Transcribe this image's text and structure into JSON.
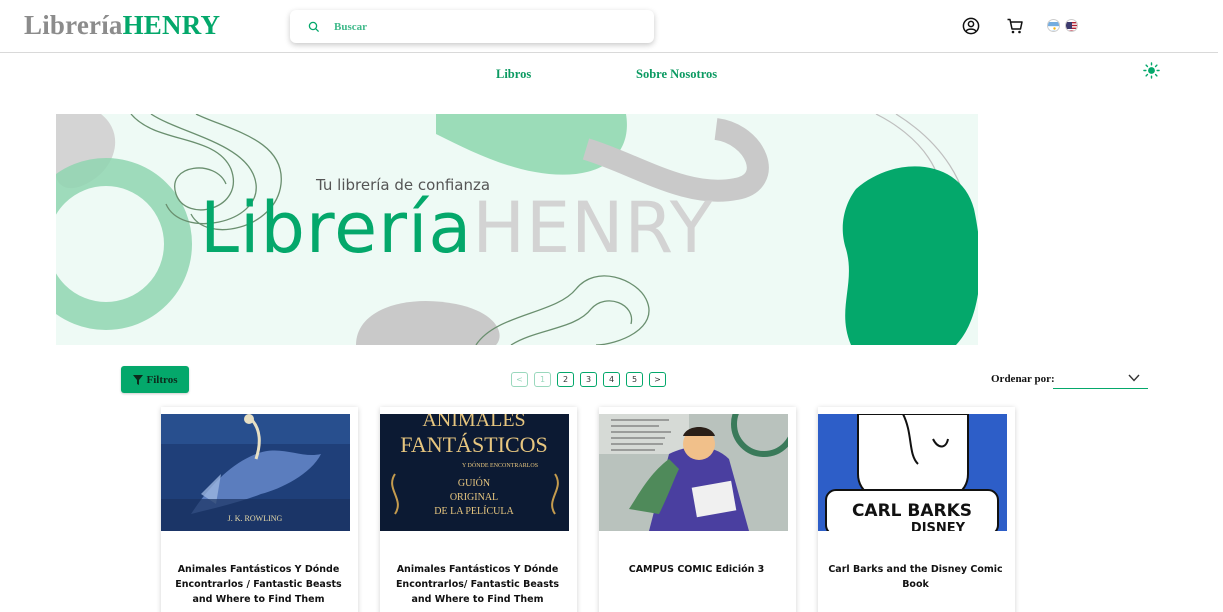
{
  "header": {
    "logo_part1": "Librería",
    "logo_part2": "HENRY",
    "search_placeholder": "Buscar",
    "icons": [
      "search-icon",
      "user-icon",
      "cart-icon",
      "flag-argentina-icon",
      "flag-usa-icon"
    ]
  },
  "nav": {
    "books": "Libros",
    "about": "Sobre Nosotros",
    "theme_icon": "sun-icon"
  },
  "banner": {
    "tagline": "Tu librería de confianza",
    "name_part1": "Librería",
    "name_part2": "HENRY"
  },
  "controls": {
    "filters_label": "Filtros",
    "sort_label": "Ordenar por:",
    "pagination": {
      "prev": "<",
      "pages": [
        "1",
        "2",
        "3",
        "4",
        "5"
      ],
      "next": ">",
      "current": "1"
    }
  },
  "colors": {
    "accent": "#04a86b",
    "logo_gray": "#8c8c8c",
    "banner_bg": "#eefaf5"
  },
  "books": [
    {
      "title": "Animales Fantásticos Y Dónde Encontrarlos / Fantastic Beasts and Where to Find Them",
      "cover_author": "J. K. ROWLING"
    },
    {
      "title": "Animales Fantásticos Y Dónde Encontrarlos/ Fantastic Beasts and Where to Find Them",
      "cover_title": "ANIMALES",
      "cover_title2": "FANTÁSTICOS",
      "cover_sub": "Y DÓNDE ENCONTRARLOS",
      "cover_line1": "GUIÓN",
      "cover_line2": "ORIGINAL",
      "cover_line3": "DE LA PELÍCULA"
    },
    {
      "title": "CAMPUS COMIC Edición 3"
    },
    {
      "title": "Carl Barks and the Disney Comic Book",
      "cover_line1": "CARL BARKS",
      "cover_line2": "DISNEY"
    }
  ]
}
